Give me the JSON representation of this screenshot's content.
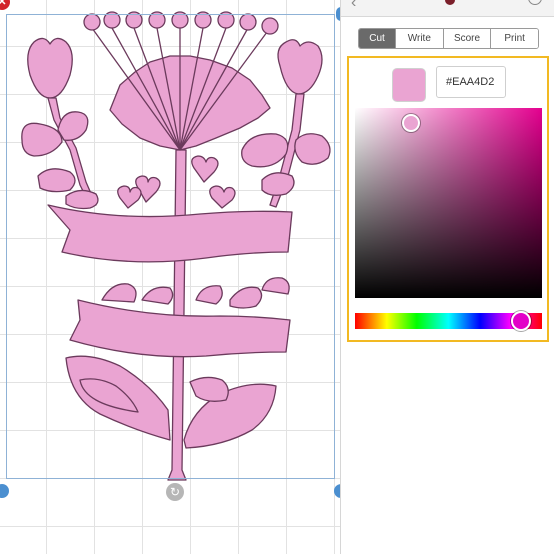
{
  "design": {
    "fill_color": "#EAA4D2",
    "outline_color": "#6b3a5c"
  },
  "canvas": {
    "handles": {
      "delete_glyph": "✕",
      "rotate_glyph": "↻"
    }
  },
  "panel": {
    "tabs": [
      {
        "label": "Cut",
        "active": true
      },
      {
        "label": "Write",
        "active": false
      },
      {
        "label": "Score",
        "active": false
      },
      {
        "label": "Print",
        "active": false
      }
    ],
    "color_picker": {
      "hex_value": "#EAA4D2",
      "swatch_color": "#EAA4D2",
      "base_hue_color": "#E4008F",
      "saturation": 0.3,
      "brightness": 0.92,
      "hue_position": 0.89,
      "highlight_color": "#F2B922"
    }
  }
}
